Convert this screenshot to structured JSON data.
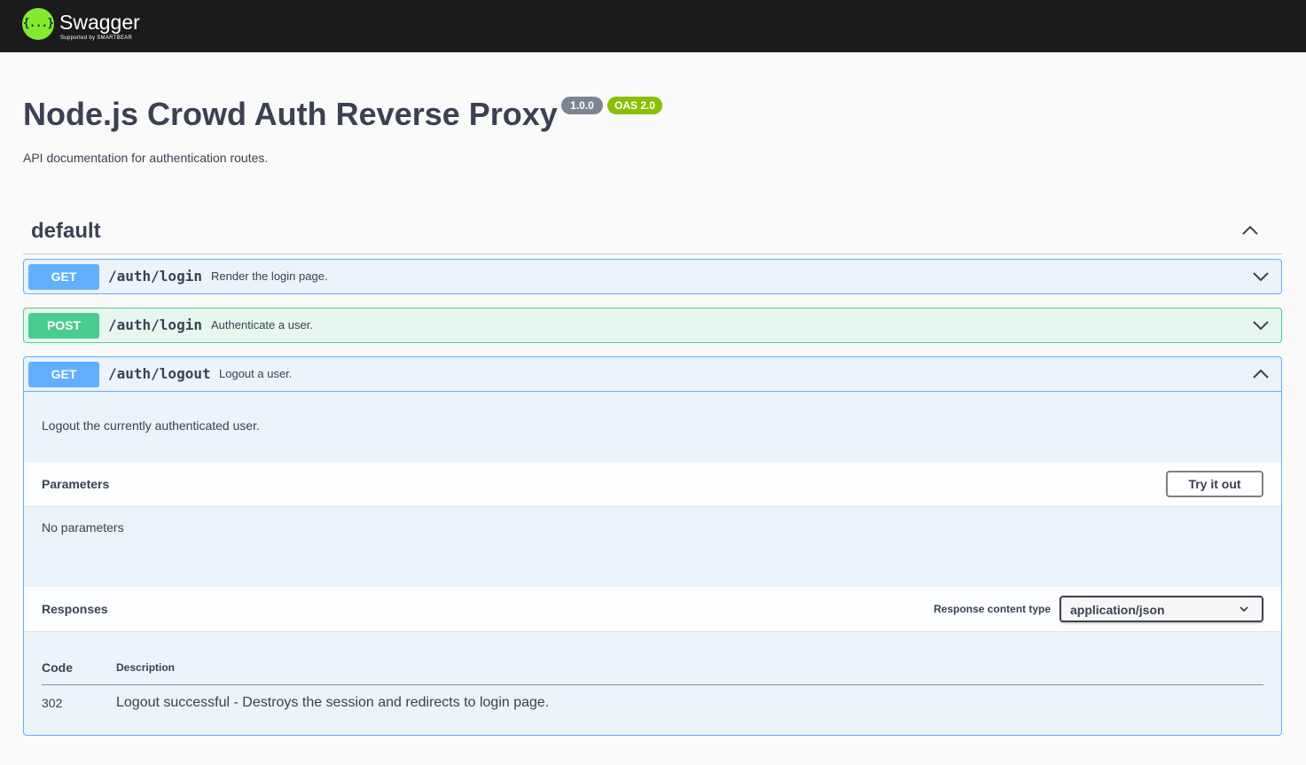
{
  "topbar": {
    "brand": "Swagger",
    "sub": "Supported by SMARTBEAR",
    "logo_glyph": "{...}",
    "logo_icon": "swagger-logo-icon"
  },
  "info": {
    "title": "Node.js Crowd Auth Reverse Proxy",
    "version": "1.0.0",
    "oas": "OAS 2.0",
    "description": "API documentation for authentication routes."
  },
  "section": {
    "title": "default",
    "toggle_icon": "chevron-up-icon"
  },
  "operations": [
    {
      "method": "GET",
      "path": "/auth/login",
      "summary": "Render the login page.",
      "expanded": false
    },
    {
      "method": "POST",
      "path": "/auth/login",
      "summary": "Authenticate a user.",
      "expanded": false
    },
    {
      "method": "GET",
      "path": "/auth/logout",
      "summary": "Logout a user.",
      "expanded": true,
      "description": "Logout the currently authenticated user.",
      "parameters_title": "Parameters",
      "try_label": "Try it out",
      "no_params": "No parameters",
      "responses_title": "Responses",
      "response_content_type_label": "Response content type",
      "response_content_type": "application/json",
      "code_header": "Code",
      "description_header": "Description",
      "responses": [
        {
          "code": "302",
          "description": "Logout successful - Destroys the session and redirects to login page."
        }
      ]
    }
  ],
  "colors": {
    "topbar": "#1b1b1b",
    "logo": "#85ea2d",
    "get": "#61affe",
    "post": "#49cc90",
    "version_badge": "#7d8492",
    "oas_badge": "#89bf04"
  }
}
